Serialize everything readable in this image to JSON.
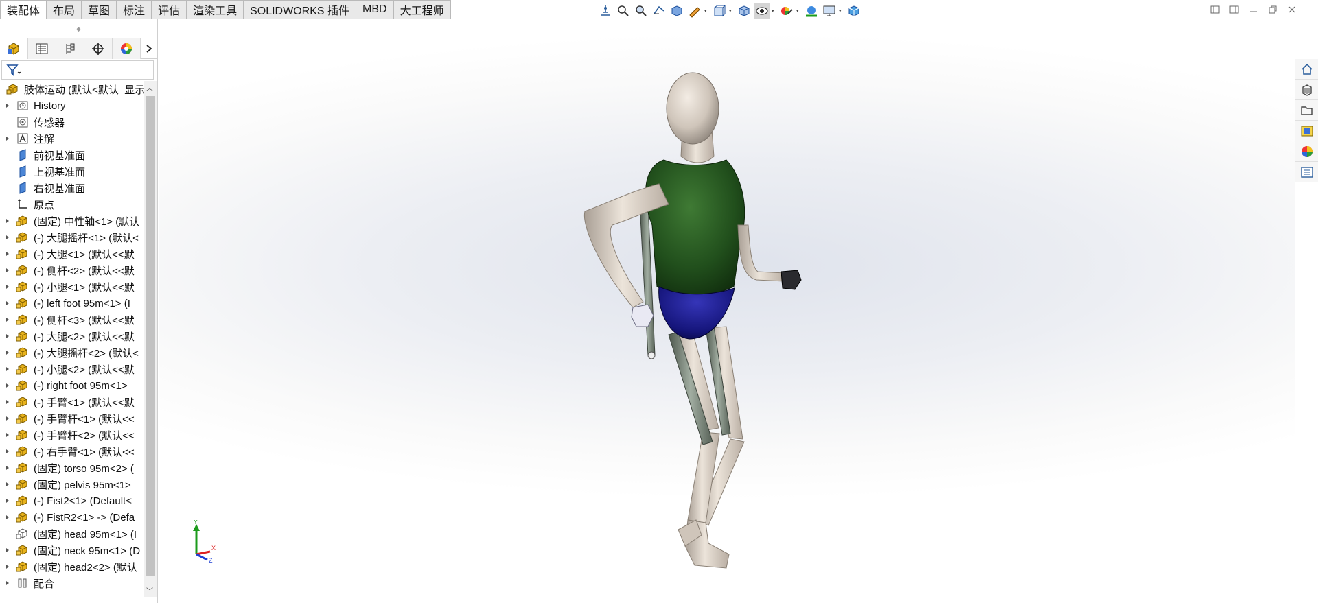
{
  "command_tabs": [
    {
      "label": "装配体",
      "active": true
    },
    {
      "label": "布局"
    },
    {
      "label": "草图"
    },
    {
      "label": "标注"
    },
    {
      "label": "评估"
    },
    {
      "label": "渲染工具"
    },
    {
      "label": "SOLIDWORKS 插件"
    },
    {
      "label": "MBD"
    },
    {
      "label": "大工程师"
    }
  ],
  "manager_tabs": [
    "feature-manager",
    "property-manager",
    "configuration-manager",
    "dimxpert-manager",
    "display-manager"
  ],
  "tree": {
    "root": "肢体运动 (默认<默认_显示",
    "items": [
      {
        "label": "History",
        "icon": "history",
        "expander": true
      },
      {
        "label": "传感器",
        "icon": "sensor",
        "expander": false
      },
      {
        "label": "注解",
        "icon": "annotation",
        "expander": true
      },
      {
        "label": "前视基准面",
        "icon": "plane",
        "expander": false
      },
      {
        "label": "上视基准面",
        "icon": "plane",
        "expander": false
      },
      {
        "label": "右视基准面",
        "icon": "plane",
        "expander": false
      },
      {
        "label": "原点",
        "icon": "origin",
        "expander": false
      },
      {
        "label": "(固定) 中性轴<1> (默认",
        "icon": "part",
        "expander": true
      },
      {
        "label": "(-) 大腿摇杆<1> (默认<",
        "icon": "part",
        "expander": true
      },
      {
        "label": "(-) 大腿<1> (默认<<默",
        "icon": "part",
        "expander": true
      },
      {
        "label": "(-) 侧杆<2> (默认<<默",
        "icon": "part",
        "expander": true
      },
      {
        "label": "(-) 小腿<1> (默认<<默",
        "icon": "part",
        "expander": true
      },
      {
        "label": "(-) left foot 95m<1> (I",
        "icon": "part",
        "expander": true
      },
      {
        "label": "(-) 侧杆<3> (默认<<默",
        "icon": "part",
        "expander": true
      },
      {
        "label": "(-) 大腿<2> (默认<<默",
        "icon": "part",
        "expander": true
      },
      {
        "label": "(-) 大腿摇杆<2> (默认<",
        "icon": "part",
        "expander": true
      },
      {
        "label": "(-) 小腿<2> (默认<<默",
        "icon": "part",
        "expander": true
      },
      {
        "label": "(-) right foot 95m<1> ",
        "icon": "part",
        "expander": true
      },
      {
        "label": "(-) 手臂<1> (默认<<默",
        "icon": "part",
        "expander": true
      },
      {
        "label": "(-) 手臂杆<1> (默认<<",
        "icon": "part",
        "expander": true
      },
      {
        "label": "(-) 手臂杆<2> (默认<<",
        "icon": "part",
        "expander": true
      },
      {
        "label": "(-) 右手臂<1> (默认<<",
        "icon": "part",
        "expander": true
      },
      {
        "label": "(固定) torso 95m<2> (",
        "icon": "part",
        "expander": true
      },
      {
        "label": "(固定) pelvis 95m<1> ",
        "icon": "part",
        "expander": true
      },
      {
        "label": "(-) Fist2<1> (Default<",
        "icon": "part",
        "expander": true
      },
      {
        "label": "(-) FistR2<1> -> (Defa",
        "icon": "part",
        "expander": true
      },
      {
        "label": "(固定) head 95m<1> (I",
        "icon": "part-outline",
        "expander": false
      },
      {
        "label": "(固定) neck 95m<1> (D",
        "icon": "part",
        "expander": true
      },
      {
        "label": "(固定) head2<2> (默认",
        "icon": "part",
        "expander": true
      },
      {
        "label": "配合",
        "icon": "mates",
        "expander": true
      }
    ]
  },
  "hud_icons": [
    "view-normal-icon",
    "zoom-fit-icon",
    "zoom-area-icon",
    "previous-view-icon",
    "section-view-icon",
    "dynamic-annotation-icon",
    "view-orientation-icon",
    "display-style-icon",
    "hide-show-icon",
    "edit-appearance-icon",
    "apply-scene-icon",
    "view-settings-icon",
    "display-3d-icon"
  ],
  "task_pane_icons": [
    "home-icon",
    "design-library-icon",
    "file-explorer-icon",
    "view-palette-icon",
    "appearances-icon",
    "custom-properties-icon"
  ],
  "triad": {
    "x": "X",
    "y": "Y",
    "z": "Z"
  },
  "colors": {
    "shirt": "#1f4d1a",
    "shorts": "#1a1a78",
    "skin": "#d8cfc4",
    "rods": "#7c8a7c",
    "part_icon": "#e8b31c"
  }
}
